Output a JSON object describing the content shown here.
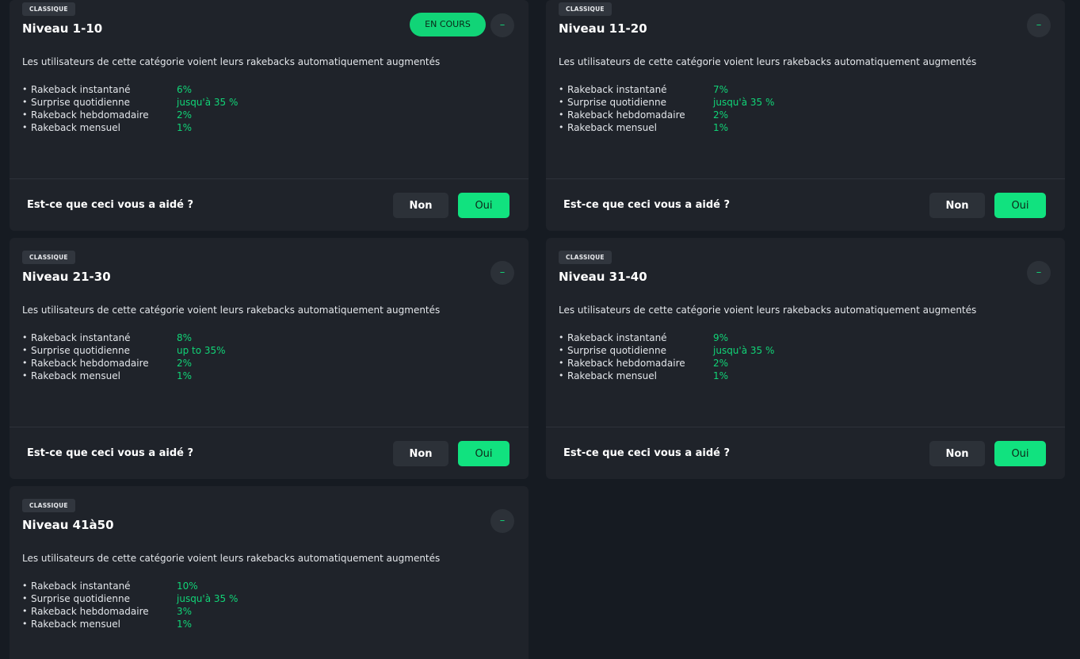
{
  "cards": [
    {
      "tag": "CLASSIQUE",
      "title": "Niveau 1-10",
      "status": "EN COURS",
      "collapse": "–",
      "description": "Les utilisateurs de cette catégorie voient leurs rakebacks automatiquement augmentés",
      "benefits": [
        {
          "label": "Rakeback instantané",
          "value": "6%"
        },
        {
          "label": "Surprise quotidienne",
          "value": "jusqu'à 35 %"
        },
        {
          "label": "Rakeback hebdomadaire",
          "value": "2%"
        },
        {
          "label": "Rakeback mensuel",
          "value": "1%"
        }
      ],
      "feedback": {
        "question": "Est-ce que ceci vous a aidé ?",
        "no": "Non",
        "yes": "Oui"
      }
    },
    {
      "tag": "CLASSIQUE",
      "title": "Niveau 11-20",
      "collapse": "–",
      "description": "Les utilisateurs de cette catégorie voient leurs rakebacks automatiquement augmentés",
      "benefits": [
        {
          "label": "Rakeback instantané",
          "value": "7%"
        },
        {
          "label": "Surprise quotidienne",
          "value": "jusqu'à 35 %"
        },
        {
          "label": "Rakeback hebdomadaire",
          "value": "2%"
        },
        {
          "label": "Rakeback mensuel",
          "value": "1%"
        }
      ],
      "feedback": {
        "question": "Est-ce que ceci vous a aidé ?",
        "no": "Non",
        "yes": "Oui"
      }
    },
    {
      "tag": "CLASSIQUE",
      "title": "Niveau 21-30",
      "collapse": "–",
      "description": "Les utilisateurs de cette catégorie voient leurs rakebacks automatiquement augmentés",
      "benefits": [
        {
          "label": "Rakeback instantané",
          "value": "8%"
        },
        {
          "label": "Surprise quotidienne",
          "value": "up to 35%"
        },
        {
          "label": "Rakeback hebdomadaire",
          "value": "2%"
        },
        {
          "label": "Rakeback mensuel",
          "value": "1%"
        }
      ],
      "feedback": {
        "question": "Est-ce que ceci vous a aidé ?",
        "no": "Non",
        "yes": "Oui"
      }
    },
    {
      "tag": "CLASSIQUE",
      "title": "Niveau 31-40",
      "collapse": "–",
      "description": "Les utilisateurs de cette catégorie voient leurs rakebacks automatiquement augmentés",
      "benefits": [
        {
          "label": "Rakeback instantané",
          "value": "9%"
        },
        {
          "label": "Surprise quotidienne",
          "value": "jusqu'à 35 %"
        },
        {
          "label": "Rakeback hebdomadaire",
          "value": "2%"
        },
        {
          "label": "Rakeback mensuel",
          "value": "1%"
        }
      ],
      "feedback": {
        "question": "Est-ce que ceci vous a aidé ?",
        "no": "Non",
        "yes": "Oui"
      }
    },
    {
      "tag": "CLASSIQUE",
      "title": "Niveau 41à50",
      "collapse": "–",
      "description": "Les utilisateurs de cette catégorie voient leurs rakebacks automatiquement augmentés",
      "benefits": [
        {
          "label": "Rakeback instantané",
          "value": "10%"
        },
        {
          "label": "Surprise quotidienne",
          "value": "jusqu'à 35 %"
        },
        {
          "label": "Rakeback hebdomadaire",
          "value": "3%"
        },
        {
          "label": "Rakeback mensuel",
          "value": "1%"
        }
      ]
    }
  ]
}
